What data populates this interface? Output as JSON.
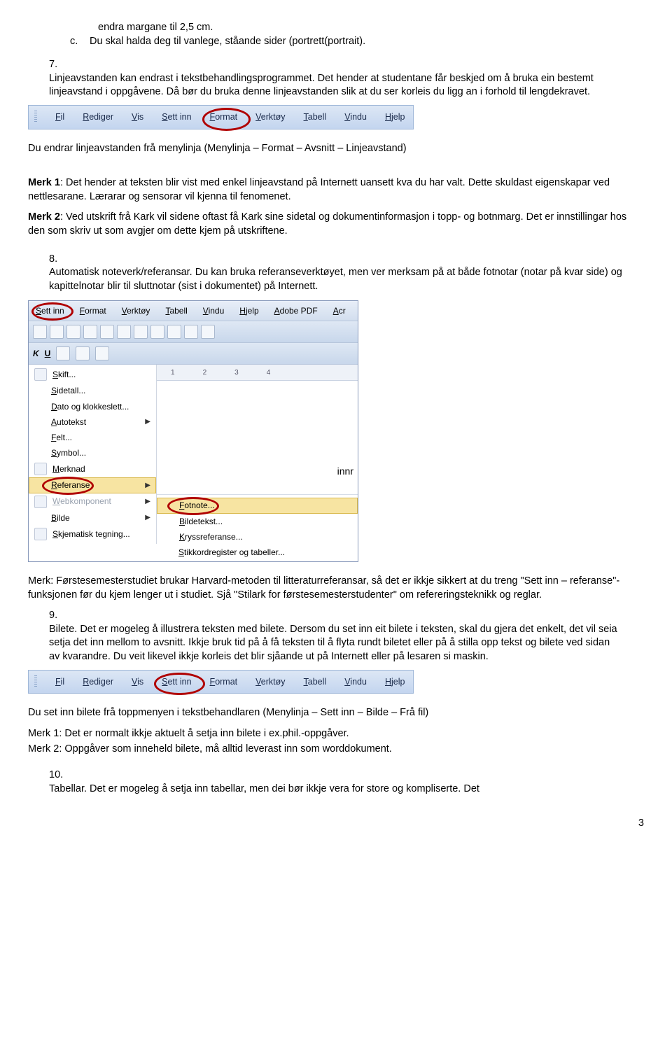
{
  "top_list": {
    "c_line": "endra margane til 2,5 cm.",
    "c_label": "c.",
    "c_text": "Du skal halda deg til vanlege, ståande sider (portrett(portrait)."
  },
  "item7": {
    "num": "7.",
    "text": "Linjeavstanden kan endrast i tekstbehandlingsprogrammet. Det hender at studentane får beskjed om å bruka ein bestemt linjeavstand i oppgåvene. Då bør du bruka denne linjeavstanden slik at du ser korleis du ligg an i forhold til lengdekravet."
  },
  "menubar1": {
    "items": [
      "Fil",
      "Rediger",
      "Vis",
      "Sett inn",
      "Format",
      "Verktøy",
      "Tabell",
      "Vindu",
      "Hjelp"
    ],
    "circled_index": 4
  },
  "after_menu1": "Du endrar linjeavstanden frå menylinja (Menylinja – Format – Avsnitt – Linjeavstand)",
  "merk1": {
    "label": "Merk 1",
    "text": ": Det hender at teksten blir vist med enkel linjeavstand på Internett uansett kva du har valt. Dette skuldast eigenskapar ved nettlesarane. Lærarar og sensorar vil kjenna til fenomenet."
  },
  "merk2": {
    "label": "Merk 2",
    "text": ": Ved utskrift frå Kark vil sidene oftast få Kark sine sidetal og dokumentinformasjon i topp- og botnmarg. Det er innstillingar hos den som skriv ut som avgjer om dette kjem på utskriftene."
  },
  "item8": {
    "num": "8.",
    "text": "Automatisk noteverk/referansar. Du kan bruka referanseverktøyet, men ver merksam på at både fotnotar (notar på kvar side) og kapittelnotar blir til sluttnotar (sist i dokumentet) på Internett."
  },
  "wordshot": {
    "topmenu": [
      "Sett inn",
      "Format",
      "Verktøy",
      "Tabell",
      "Vindu",
      "Hjelp",
      "Adobe PDF",
      "Acr"
    ],
    "fmt_k": "K",
    "fmt_u": "U",
    "left_items": [
      {
        "label": "Skift...",
        "icon": true
      },
      {
        "label": "Sidetall...",
        "icon": false
      },
      {
        "label": "Dato og klokkeslett...",
        "icon": false
      },
      {
        "label": "Autotekst",
        "icon": false,
        "arrow": true
      },
      {
        "label": "Felt...",
        "icon": false
      },
      {
        "label": "Symbol...",
        "icon": false
      },
      {
        "label": "Merknad",
        "icon": true
      },
      {
        "label": "Referanse",
        "icon": false,
        "arrow": true,
        "highlight": true
      },
      {
        "label": "Webkomponent",
        "icon": true,
        "arrow": true,
        "disabled": true
      },
      {
        "label": "Bilde",
        "icon": false,
        "arrow": true
      },
      {
        "label": "Skjematisk tegning...",
        "icon": true
      }
    ],
    "right_items": [
      {
        "label": "Fotnote...",
        "highlight": true
      },
      {
        "label": "Bildetekst..."
      },
      {
        "label": "Kryssreferanse..."
      },
      {
        "label": "Stikkordregister og tabeller..."
      }
    ],
    "ruler_ticks": [
      "1",
      "2",
      "3",
      "4"
    ],
    "floating_text": "innr"
  },
  "after_wordshot": "Merk: Førstesemesterstudiet brukar Harvard-metoden til litteraturreferansar, så det er ikkje sikkert at du treng \"Sett inn – referanse\"-funksjonen før du kjem lenger ut i studiet. Sjå \"Stilark for førstesemesterstudenter\" om refereringsteknikk og reglar.",
  "item9": {
    "num": "9.",
    "text": "Bilete. Det er mogeleg å illustrera teksten med bilete. Dersom du set inn eit bilete i teksten, skal du gjera det enkelt, det vil seia setja det inn mellom to avsnitt. Ikkje bruk tid på å få teksten til å flyta rundt biletet eller på å stilla opp tekst og bilete ved sidan av kvarandre. Du veit likevel ikkje korleis det blir sjåande ut på Internett eller på lesaren si maskin."
  },
  "menubar2": {
    "items": [
      "Fil",
      "Rediger",
      "Vis",
      "Sett inn",
      "Format",
      "Verktøy",
      "Tabell",
      "Vindu",
      "Hjelp"
    ],
    "circled_index": 3
  },
  "after_menu2": "Du set inn bilete frå toppmenyen i tekstbehandlaren (Menylinja – Sett inn – Bilde – Frå fil)",
  "merk_b1": "Merk 1: Det er normalt ikkje aktuelt å setja inn bilete i ex.phil.-oppgåver.",
  "merk_b2": "Merk 2: Oppgåver som inneheld bilete, må alltid leverast inn som worddokument.",
  "item10": {
    "num": "10.",
    "text": "Tabellar. Det er mogeleg å setja inn tabellar, men dei bør ikkje vera for store og kompliserte. Det"
  },
  "page_number": "3"
}
